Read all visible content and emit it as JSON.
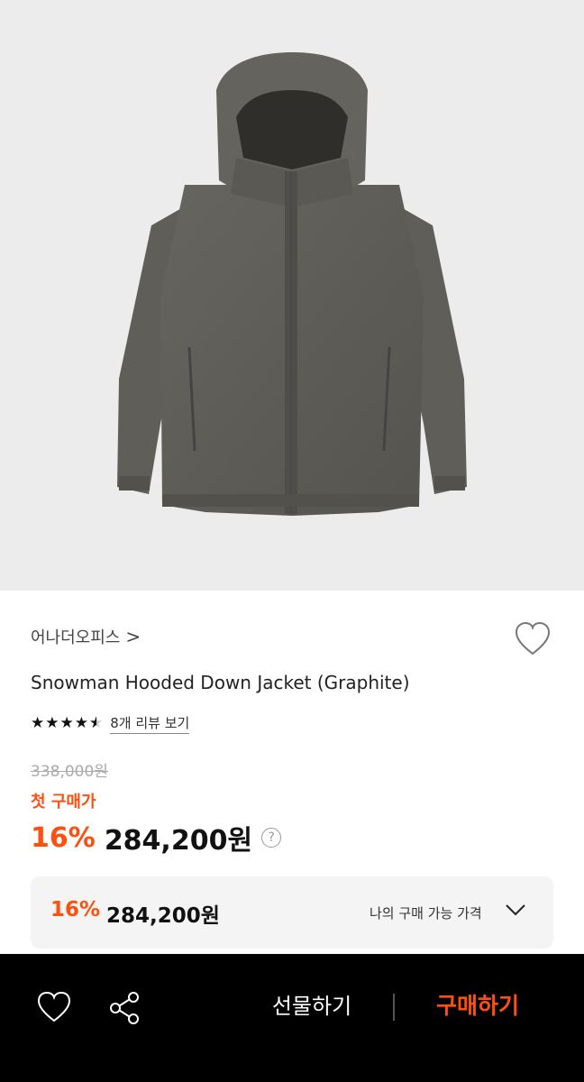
{
  "product": {
    "brand": "어나더오피스",
    "brand_chevron": ">",
    "title": "Snowman Hooded Down Jacket (Graphite)",
    "rating": 4.5,
    "review_link": "8개 리뷰 보기",
    "original_price": "338,000원",
    "first_purchase_label": "첫 구매가",
    "discount": "16%",
    "price": "284,200원",
    "help_symbol": "?"
  },
  "my_price": {
    "discount": "16%",
    "price": "284,200원",
    "label": "나의 구매 가능 가격"
  },
  "bottom_bar": {
    "gift_label": "선물하기",
    "buy_label": "구매하기"
  },
  "colors": {
    "accent": "#ff4f0f",
    "jacket": "#5c5b57",
    "bar": "#000000"
  },
  "icons": [
    "heart-icon",
    "star-icon",
    "help-icon",
    "chevron-down-icon",
    "share-icon"
  ]
}
